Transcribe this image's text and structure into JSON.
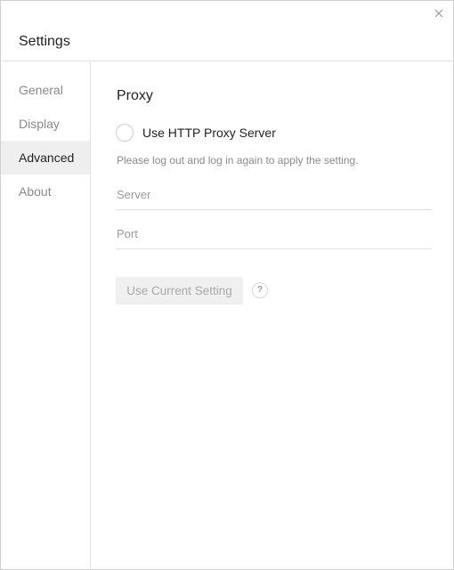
{
  "window": {
    "title": "Settings"
  },
  "sidebar": {
    "items": [
      {
        "label": "General",
        "active": false
      },
      {
        "label": "Display",
        "active": false
      },
      {
        "label": "Advanced",
        "active": true
      },
      {
        "label": "About",
        "active": false
      }
    ]
  },
  "proxy": {
    "section_title": "Proxy",
    "use_proxy_label": "Use HTTP Proxy Server",
    "use_proxy_checked": false,
    "hint": "Please log out and log in again to apply the setting.",
    "server_placeholder": "Server",
    "server_value": "",
    "port_placeholder": "Port",
    "port_value": "",
    "apply_button_label": "Use Current Setting",
    "help_icon_glyph": "?"
  },
  "colors": {
    "active_nav_bg": "#efefef",
    "muted_text": "#8a8a8a",
    "disabled_button_bg": "#f0f0f0"
  },
  "icons": {
    "close": "close-icon",
    "help": "help-icon"
  }
}
